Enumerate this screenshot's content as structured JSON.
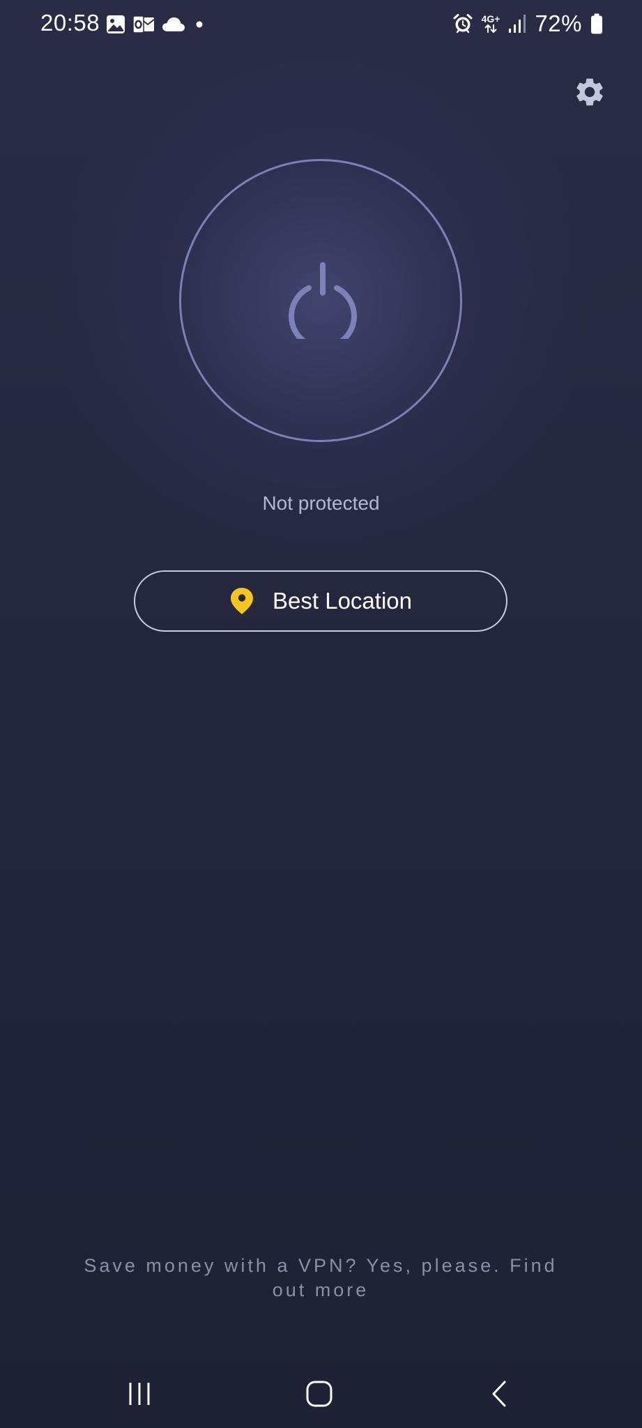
{
  "status_bar": {
    "time": "20:58",
    "network": "4G+",
    "battery": "72%",
    "icons": [
      "gallery-icon",
      "outlook-icon",
      "cloud-icon",
      "notification-dot-icon",
      "alarm-icon",
      "data-arrows-icon",
      "signal-icon",
      "battery-icon"
    ]
  },
  "header": {
    "settings_icon": "gear-icon"
  },
  "connection": {
    "power_icon": "power-icon",
    "status_text": "Not protected"
  },
  "location": {
    "label": "Best Location",
    "icon": "location-pin-icon",
    "pin_color": "#F5C518"
  },
  "promo": {
    "text": "Save money with a VPN? Yes, please. Find out more"
  },
  "nav_bar": {
    "icons": [
      "recent-apps-icon",
      "home-icon",
      "back-icon"
    ]
  },
  "colors": {
    "background": "#25273F",
    "ring": "#7E80B8",
    "status_text": "#B6B8CF",
    "accent_yellow": "#F5C518"
  }
}
